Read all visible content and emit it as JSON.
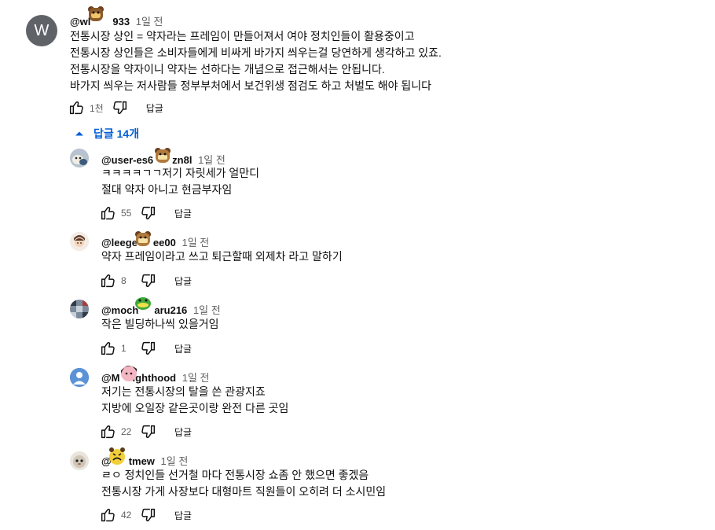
{
  "main_comment": {
    "avatar_letter": "W",
    "author": "@wl",
    "author_suffix": "933",
    "time": "1일 전",
    "lines": [
      "전통시장 상인 = 약자라는 프레임이 만들어져서 여야 정치인들이 활용중이고",
      "전통시장 상인들은 소비자들에게 비싸게 바가지 씌우는걸 당연하게 생각하고 있죠.",
      "전통시장을  약자이니  약자는 선하다는 개념으로  접근해서는 안됩니다.",
      "바가지 씌우는 저사람들 정부부처에서 보건위생 점검도 하고 처벌도 해야 됩니다"
    ],
    "likes": "1천",
    "reply_label": "답글"
  },
  "replies_toggle": {
    "label": "답글 14개",
    "icon": "chevron-up-icon",
    "color": "#065fd4"
  },
  "replies": [
    {
      "author_a": "@user-es6",
      "author_b": "zn8l",
      "time": "1일 전",
      "lines": [
        "ㅋㅋㅋㅋㄱㄱ저기 자릿세가 얼만디",
        "절대 약자 아니고 현금부자임"
      ],
      "likes": "55",
      "reply_label": "답글",
      "avatar": "avatar-dog"
    },
    {
      "author_a": "@leege",
      "author_b": "ee00",
      "time": "1일 전",
      "lines": [
        "약자 프레임이라고 쓰고 퇴근할때 외제차 라고 말하기"
      ],
      "likes": "8",
      "reply_label": "답글",
      "avatar": "avatar-person"
    },
    {
      "author_a": "@moch",
      "author_b": "aru216",
      "time": "1일 전",
      "lines": [
        "작은 빌딩하나씩 있을거임"
      ],
      "likes": "1",
      "reply_label": "답글",
      "avatar": "avatar-mosaic"
    },
    {
      "author_a": "@M",
      "author_b": "ighthood",
      "time": "1일 전",
      "lines": [
        "저기는 전통시장의 탈을 쓴 관광지죠",
        "지방에 오일장 같은곳이랑 완전 다른 곳임"
      ],
      "likes": "22",
      "reply_label": "답글",
      "avatar": "avatar-default"
    },
    {
      "author_a": "@",
      "author_b": "tmew",
      "time": "1일 전",
      "lines": [
        "ㄹㅇ 정치인들 선거철 마다 전통시장 쇼좀 안 했으면 좋겠음",
        "전통시장 가게 사장보다 대형마트 직원들이 오히려 더 소시민임"
      ],
      "likes": "42",
      "reply_label": "답글",
      "avatar": "avatar-cat"
    }
  ]
}
